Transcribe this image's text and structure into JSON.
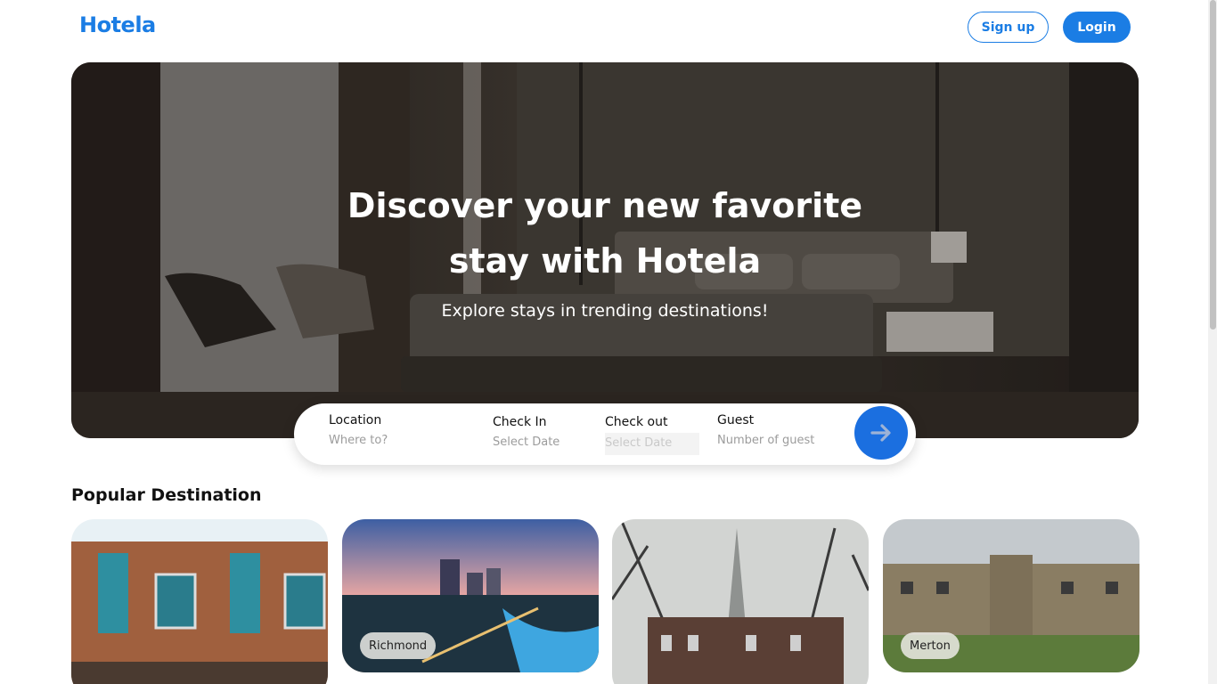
{
  "header": {
    "logo": "Hotela",
    "signup_label": "Sign up",
    "login_label": "Login"
  },
  "hero": {
    "title_line1": "Discover your new favorite",
    "title_line2": "stay with Hotela",
    "subtitle": "Explore stays in trending destinations!"
  },
  "search": {
    "location_label": "Location",
    "location_placeholder": "Where to?",
    "checkin_label": "Check In",
    "checkin_placeholder": "Select Date",
    "checkout_label": "Check out",
    "checkout_placeholder": "Select Date",
    "guest_label": "Guest",
    "guest_placeholder": "Number of guest",
    "submit_icon": "arrow-right-icon"
  },
  "popular": {
    "title": "Popular Destination",
    "cards": [
      {
        "name": ""
      },
      {
        "name": "Richmond"
      },
      {
        "name": ""
      },
      {
        "name": "Merton"
      }
    ]
  },
  "colors": {
    "brand": "#1b7de4",
    "submit": "#1b6fe0"
  }
}
